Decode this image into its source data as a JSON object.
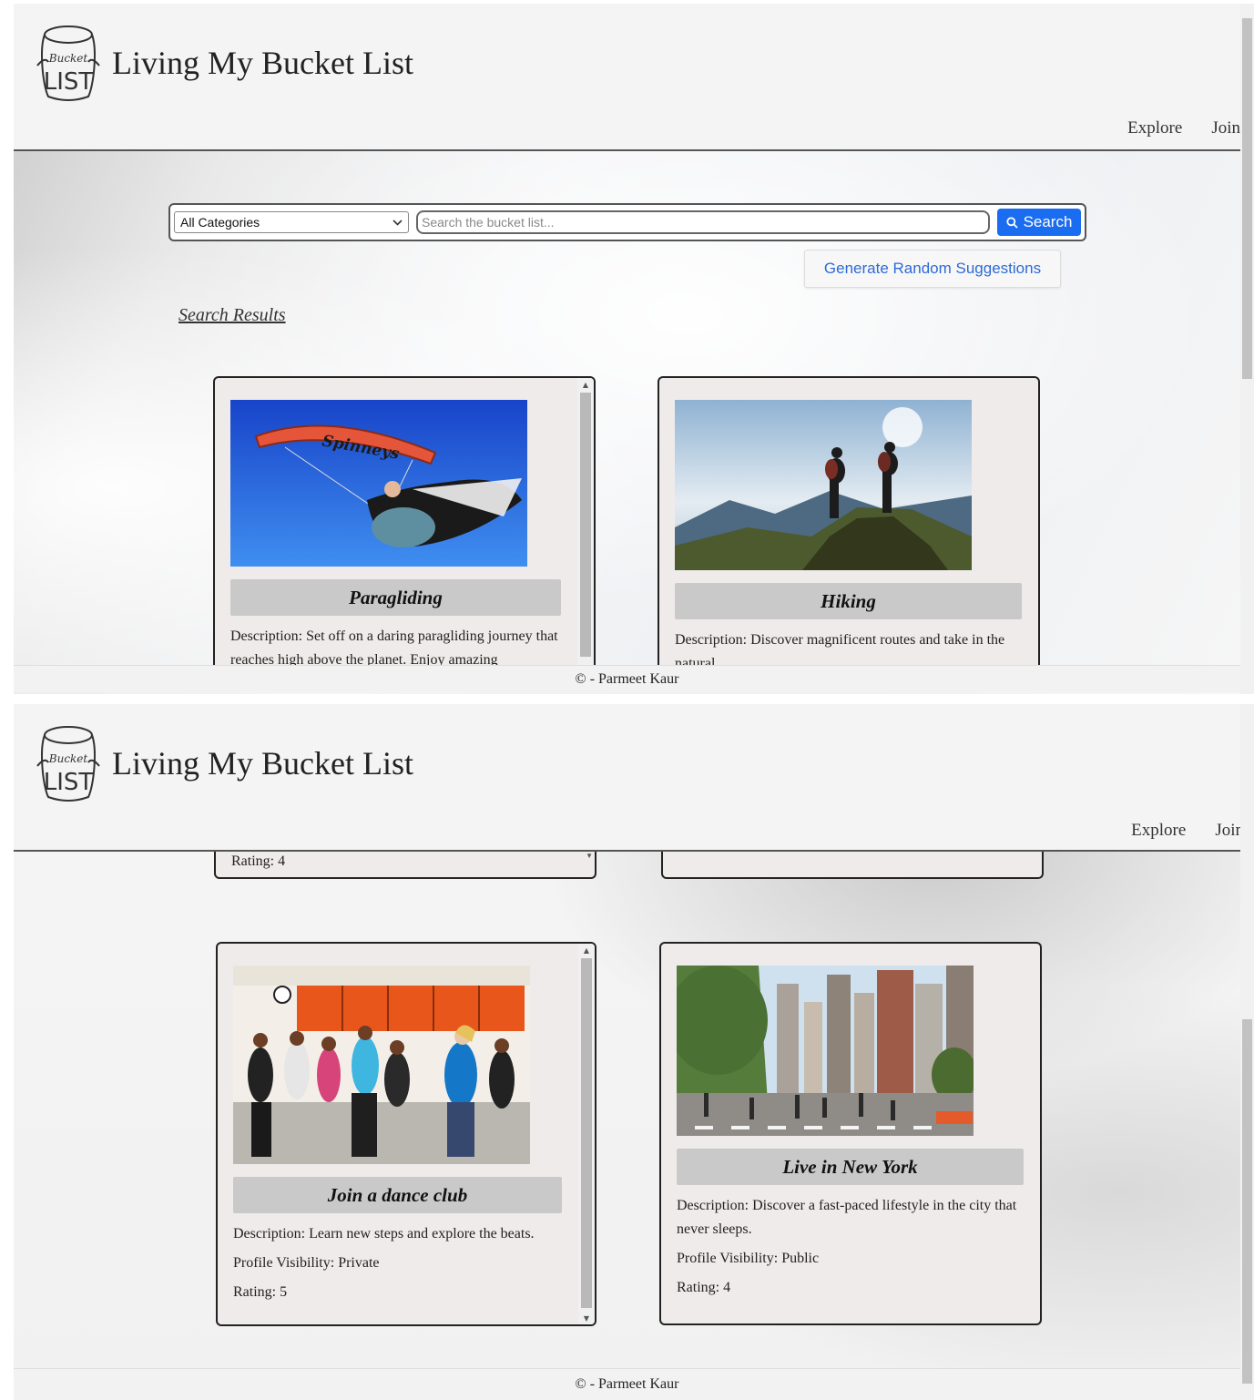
{
  "site": {
    "title": "Living My Bucket List",
    "logo_text_top": "Bucket",
    "logo_text_bottom": "LIST"
  },
  "nav": {
    "explore": "Explore",
    "join": "Join"
  },
  "search": {
    "category": "All Categories",
    "placeholder": "Search the bucket list...",
    "button_label": "Search",
    "random_label": "Generate Random Suggestions",
    "results_heading": "Search Results"
  },
  "cards": {
    "paragliding": {
      "title": "Paragliding",
      "description": "Description: Set off on a daring paragliding journey that reaches high above the planet. Enjoy amazing",
      "rating": "Rating: 4",
      "wing_text": "Spinneys"
    },
    "hiking": {
      "title": "Hiking",
      "description": "Description: Discover magnificent routes and take in the natural"
    },
    "dance": {
      "title": "Join a dance club",
      "description": "Description: Learn new steps and explore the beats.",
      "visibility": "Profile Visibility: Private",
      "rating": "Rating: 5"
    },
    "newyork": {
      "title": "Live in New York",
      "description": "Description: Discover a fast-paced lifestyle in the city that never sleeps.",
      "visibility": "Profile Visibility: Public",
      "rating": "Rating: 4"
    }
  },
  "footer": {
    "text": "© - Parmeet Kaur"
  },
  "colors": {
    "accent": "#1a6cf0",
    "link": "#2d6bd6",
    "card_bg": "#efebea",
    "title_bar": "#c9c9c9"
  },
  "icons": {
    "search": "search-icon",
    "chevron": "chevron-down-icon",
    "logo": "bucket-logo"
  }
}
